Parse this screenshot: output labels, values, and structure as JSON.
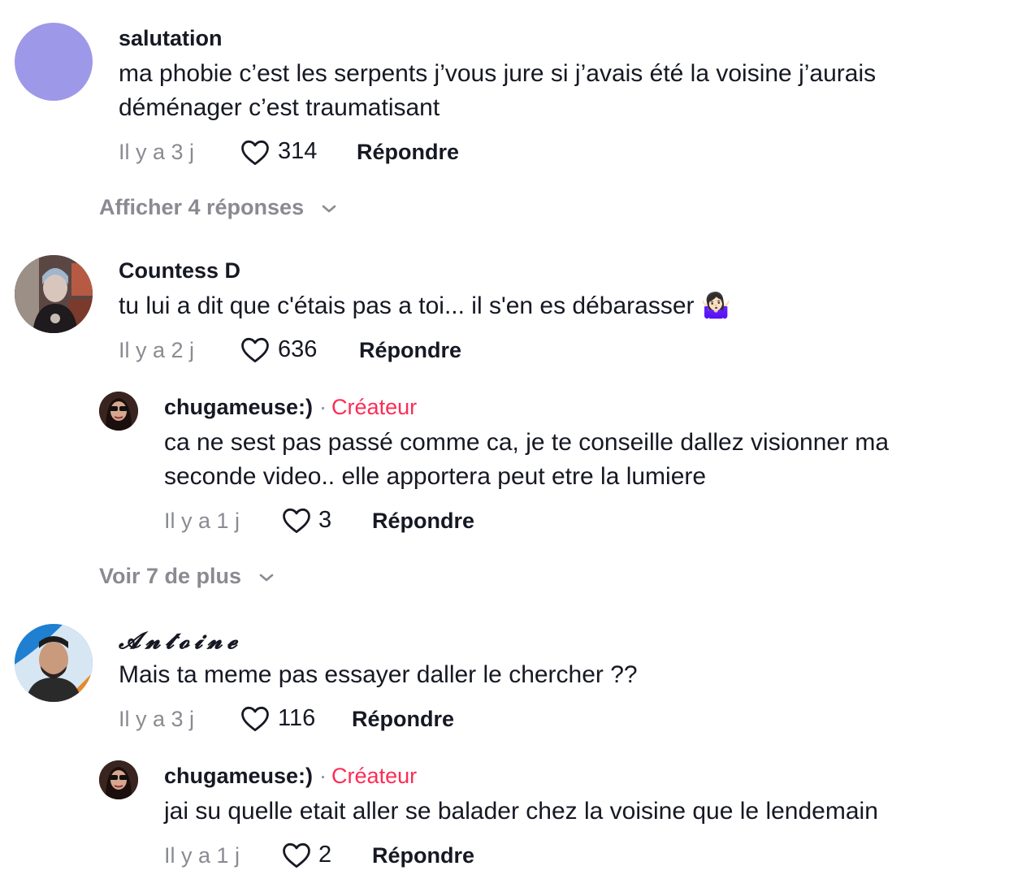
{
  "comments": [
    {
      "username": "salutation",
      "text": "ma phobie c’est les serpents j’vous jure si j’avais été la voisine j’aurais déménager c’est traumatisant",
      "time": "Il y a 3 j",
      "likes": "314",
      "reply_label": "Répondre",
      "show_replies": "Afficher 4 réponses"
    },
    {
      "username": "Countess D",
      "text": "tu lui a dit que c'étais pas a toi... il s'en es débarasser 🤷🏻‍♀️",
      "time": "Il y a 2 j",
      "likes": "636",
      "reply_label": "Répondre",
      "reply": {
        "username": "chugameuse:)",
        "separator": "·",
        "badge": "Créateur",
        "text": "ca ne sest pas passé comme ca, je te conseille dallez visionner ma seconde video.. elle apportera peut etre la lumiere",
        "time": "Il y a 1 j",
        "likes": "3",
        "reply_label": "Répondre"
      },
      "show_more": "Voir 7 de plus"
    },
    {
      "username": "𝓐𝓷𝓽𝓸𝓲𝓷𝓮",
      "text": "Mais ta meme pas essayer daller le chercher ??",
      "time": "Il y a 3 j",
      "likes": "116",
      "reply_label": "Répondre",
      "reply": {
        "username": "chugameuse:)",
        "separator": "·",
        "badge": "Créateur",
        "text": "jai su quelle etait aller se balader chez la voisine que le lendemain",
        "time": "Il y a 1 j",
        "likes": "2",
        "reply_label": "Répondre"
      }
    }
  ],
  "icons": {
    "like": "heart-outline-icon",
    "expand": "chevron-down-icon"
  },
  "colors": {
    "creator_badge": "#fe2c55",
    "muted": "#8a8b91",
    "avatar_salutation": "#9e98e8"
  }
}
